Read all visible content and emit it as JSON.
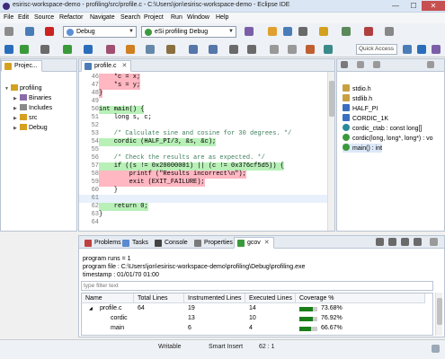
{
  "window": {
    "title": "esirisc-workspace-demo - profiling/src/profile.c - C:\\Users\\jon\\esirisc-workspace-demo - Eclipse IDE",
    "minimize": "—",
    "maximize": "☐",
    "close": "✕"
  },
  "menu": [
    "File",
    "Edit",
    "Source",
    "Refactor",
    "Navigate",
    "Search",
    "Project",
    "Run",
    "Window",
    "Help"
  ],
  "toolbar": {
    "build_config": "Debug",
    "launch_config": "eSi profiling Debug",
    "quick_access_placeholder": "Quick Access"
  },
  "project_explorer": {
    "tab_label": "Projec...",
    "tree": [
      {
        "label": "profiling",
        "level": 0,
        "expanded": true
      },
      {
        "label": "Binaries",
        "level": 1,
        "expanded": false
      },
      {
        "label": "Includes",
        "level": 1,
        "expanded": false
      },
      {
        "label": "src",
        "level": 1,
        "expanded": false
      },
      {
        "label": "Debug",
        "level": 1,
        "expanded": false
      }
    ]
  },
  "editor": {
    "tab_label": "profile.c",
    "lines": [
      {
        "num": "46",
        "text": "    *c = x;",
        "style": "red"
      },
      {
        "num": "47",
        "text": "    *s = y;",
        "style": "red"
      },
      {
        "num": "48",
        "text": "}",
        "style": "red"
      },
      {
        "num": "49",
        "text": "",
        "style": ""
      },
      {
        "num": "50",
        "text": "int main() {",
        "style": "green"
      },
      {
        "num": "51",
        "text": "    long s, c;",
        "style": ""
      },
      {
        "num": "52",
        "text": "",
        "style": ""
      },
      {
        "num": "53",
        "text": "    /* Calculate sine and cosine for 30 degrees. */",
        "style": "comment"
      },
      {
        "num": "54",
        "text": "    cordic (HALF_PI/3, &s, &c);",
        "style": "green"
      },
      {
        "num": "55",
        "text": "",
        "style": ""
      },
      {
        "num": "56",
        "text": "    /* Check the results are as expected. */",
        "style": "comment"
      },
      {
        "num": "57",
        "text": "    if ((s != 0x20000001) || (c != 0x376cf5d5)) {",
        "style": "green"
      },
      {
        "num": "58",
        "text": "        printf (\"Results incorrect\\n\");",
        "style": "red"
      },
      {
        "num": "59",
        "text": "        exit (EXIT_FAILURE);",
        "style": "red"
      },
      {
        "num": "60",
        "text": "    }",
        "style": ""
      },
      {
        "num": "61",
        "text": "",
        "style": "cur"
      },
      {
        "num": "62",
        "text": "    return 0;",
        "style": "green"
      },
      {
        "num": "63",
        "text": "}",
        "style": ""
      },
      {
        "num": "64",
        "text": "",
        "style": ""
      }
    ]
  },
  "outline": {
    "items": [
      {
        "label": "stdio.h",
        "kind": "include"
      },
      {
        "label": "stdlib.h",
        "kind": "include"
      },
      {
        "label": "HALF_PI",
        "kind": "macro"
      },
      {
        "label": "CORDIC_1K",
        "kind": "macro"
      },
      {
        "label": "cordic_ctab : const long[]",
        "kind": "var"
      },
      {
        "label": "cordic(long, long*, long*) : vo",
        "kind": "func"
      },
      {
        "label": "main() : int",
        "kind": "func"
      }
    ]
  },
  "bottom_tabs": [
    "Problems",
    "Tasks",
    "Console",
    "Properties",
    "gcov"
  ],
  "gcov": {
    "runs": "program runs = 1",
    "file": "program file : C:\\Users\\jon\\esirisc-workspace-demo\\profiling\\Debug\\profiling.exe",
    "timestamp": "timestamp : 01/01/70 01:00",
    "filter_placeholder": "type filter text",
    "columns": [
      "Name",
      "Total Lines",
      "Instrumented Lines",
      "Executed Lines",
      "Coverage %"
    ],
    "rows": [
      {
        "name": "profile.c",
        "total": "64",
        "instrumented": "19",
        "executed": "14",
        "coverage": "73.68%",
        "coverage_value": 0.7368,
        "indent": 0
      },
      {
        "name": "cordic",
        "total": "",
        "instrumented": "13",
        "executed": "10",
        "coverage": "76.92%",
        "coverage_value": 0.7692,
        "indent": 1
      },
      {
        "name": "main",
        "total": "",
        "instrumented": "6",
        "executed": "4",
        "coverage": "66.67%",
        "coverage_value": 0.6667,
        "indent": 1
      }
    ]
  },
  "status": {
    "writable": "Writable",
    "insert_mode": "Smart Insert",
    "position": "62 : 1"
  },
  "colors": {
    "covered": "#b8f0b8",
    "uncovered": "#ffb7c2",
    "coverage_fill": "#1a7f1a"
  }
}
